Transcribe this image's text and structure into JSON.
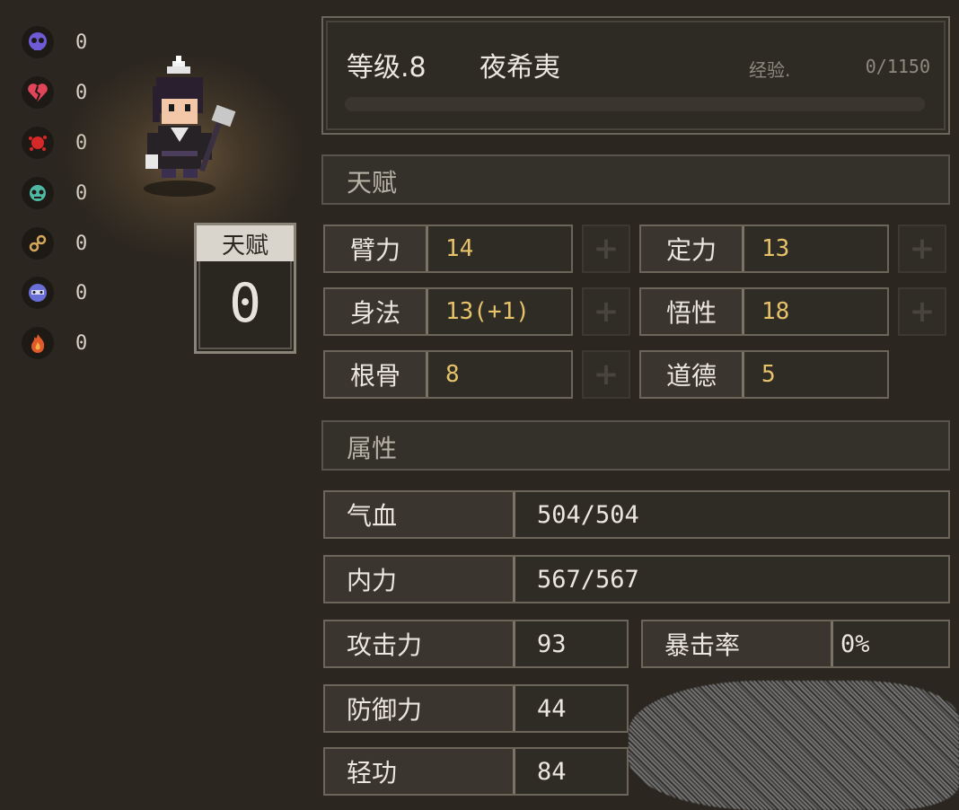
{
  "status_effects": [
    {
      "icon": "skull-icon",
      "color": "#6f5bd6",
      "count": "0"
    },
    {
      "icon": "broken-heart-icon",
      "color": "#e0455a",
      "count": "0"
    },
    {
      "icon": "blood-splat-icon",
      "color": "#d62828",
      "count": "0"
    },
    {
      "icon": "poison-skull-icon",
      "color": "#4fb8a4",
      "count": "0"
    },
    {
      "icon": "chain-icon",
      "color": "#d4a85a",
      "count": "0"
    },
    {
      "icon": "frozen-face-icon",
      "color": "#6a6fd8",
      "count": "0"
    },
    {
      "icon": "fire-icon",
      "color": "#e05a2a",
      "count": "0"
    }
  ],
  "talent_points": {
    "label": "天赋",
    "value": "0"
  },
  "header": {
    "level": "等级.8",
    "name": "夜希夷",
    "exp_label": "经验.",
    "exp_value": "0/1150",
    "exp_progress": 0
  },
  "talent_section": {
    "title": "天赋"
  },
  "talents": [
    {
      "label": "臂力",
      "value": "14"
    },
    {
      "label": "定力",
      "value": "13"
    },
    {
      "label": "身法",
      "value": "13(+1)"
    },
    {
      "label": "悟性",
      "value": "18"
    },
    {
      "label": "根骨",
      "value": "8"
    },
    {
      "label": "道德",
      "value": "5"
    }
  ],
  "attribute_section": {
    "title": "属性"
  },
  "attributes": {
    "hp": {
      "label": "气血",
      "value": "504/504"
    },
    "mp": {
      "label": "内力",
      "value": "567/567"
    },
    "attack": {
      "label": "攻击力",
      "value": "93"
    },
    "crit_rate": {
      "label": "暴击率",
      "value": "0%"
    },
    "defense": {
      "label": "防御力",
      "value": "44"
    },
    "agility": {
      "label": "轻功",
      "value": "84"
    }
  },
  "colors": {
    "accent_value": "#e6c36a",
    "background": "#2b2620"
  }
}
